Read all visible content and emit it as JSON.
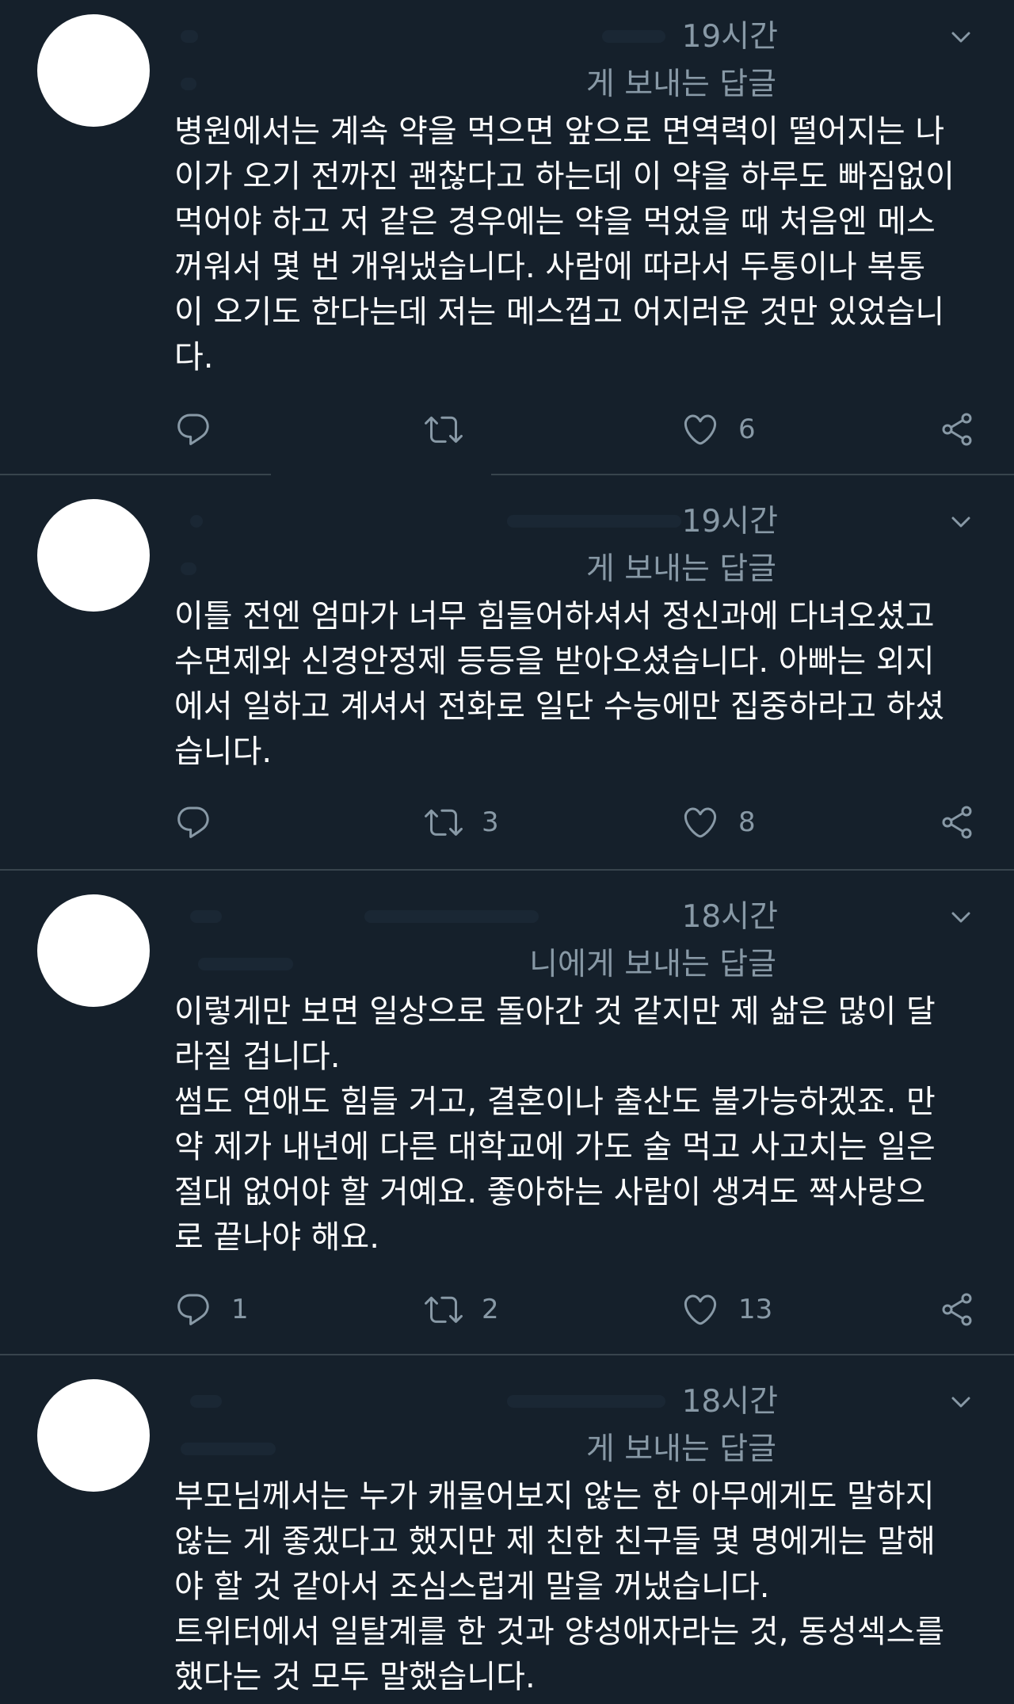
{
  "tweets": [
    {
      "time": "19시간",
      "reply_suffix": "게 보내는 답글",
      "text": "병원에서는 계속 약을 먹으면 앞으로 면역력이 떨어지는 나\n이가 오기 전까진 괜찮다고 하는데 이 약을 하루도 빠짐없이\n먹어야 하고 저 같은 경우에는 약을 먹었을 때 처음엔 메스\n꺼워서 몇 번 개워냈습니다. 사람에 따라서 두통이나 복통\n이 오기도 한다는데 저는 메스껍고 어지러운 것만 있었습니\n다.",
      "reply_count": "",
      "retweet_count": "",
      "like_count": "6"
    },
    {
      "time": "19시간",
      "reply_suffix": "게 보내는 답글",
      "text": "이틀 전엔 엄마가 너무 힘들어하셔서 정신과에 다녀오셨고\n수면제와 신경안정제 등등을 받아오셨습니다. 아빠는 외지\n에서 일하고 계셔서 전화로 일단 수능에만 집중하라고 하셨\n습니다.",
      "reply_count": "",
      "retweet_count": "3",
      "like_count": "8"
    },
    {
      "time": "18시간",
      "reply_suffix": "니에게 보내는 답글",
      "text": "이렇게만 보면 일상으로 돌아간 것 같지만 제 삶은 많이 달\n라질 겁니다.\n썸도 연애도 힘들 거고, 결혼이나 출산도 불가능하겠죠. 만\n약 제가 내년에 다른 대학교에 가도 술 먹고 사고치는 일은\n절대 없어야 할 거예요. 좋아하는 사람이 생겨도 짝사랑으\n로 끝나야 해요.",
      "reply_count": "1",
      "retweet_count": "2",
      "like_count": "13"
    },
    {
      "time": "18시간",
      "reply_suffix": "게 보내는 답글",
      "text": "부모님께서는 누가 캐물어보지 않는 한 아무에게도 말하지\n않는 게 좋겠다고 했지만 제 친한 친구들 몇 명에게는 말해\n야 할 것 같아서 조심스럽게 말을 꺼냈습니다.\n트위터에서 일탈계를 한 것과 양성애자라는 것, 동성섹스를\n했다는 것 모두 말했습니다.",
      "reply_count": "",
      "retweet_count": "",
      "like_count": ""
    }
  ],
  "icons": {
    "reply": "reply-icon",
    "retweet": "retweet-icon",
    "like": "heart-icon",
    "share": "share-icon",
    "menu": "chevron-down-icon"
  },
  "colors": {
    "background": "#15202b",
    "text": "#ffffff",
    "secondary_text": "#8899a6",
    "divider": "#38444d"
  }
}
